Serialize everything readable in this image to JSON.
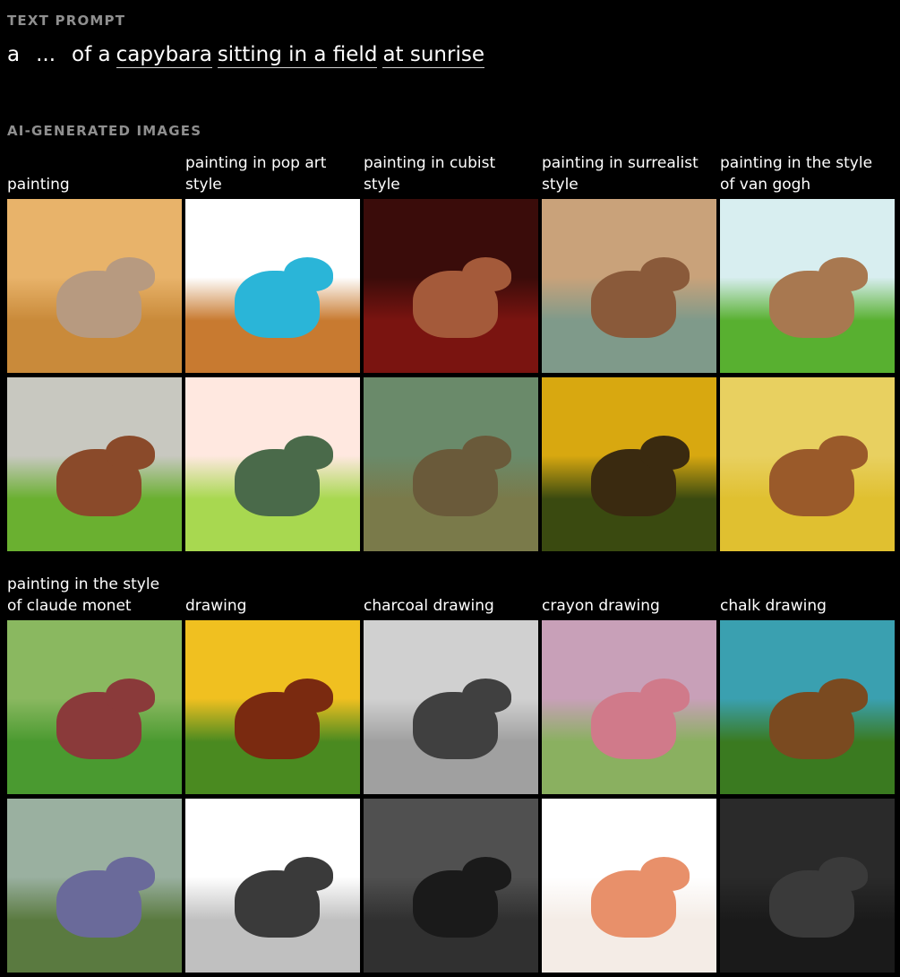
{
  "text_prompt_heading": "TEXT PROMPT",
  "prompt": {
    "a": "a",
    "ellipsis": "...",
    "of_a": "of a",
    "subject": "capybara",
    "action": "sitting in a field",
    "time": "at sunrise"
  },
  "images_heading": "AI-GENERATED IMAGES",
  "row1_labels": [
    [
      "",
      "painting"
    ],
    [
      "painting in pop art",
      "style"
    ],
    [
      "painting in cubist",
      "style"
    ],
    [
      "painting in surrealist",
      "style"
    ],
    [
      "painting in the style",
      "of van gogh"
    ]
  ],
  "row2_labels": [
    [
      "painting in the style",
      "of claude monet"
    ],
    [
      "",
      "drawing"
    ],
    [
      "",
      "charcoal drawing"
    ],
    [
      "",
      "crayon drawing"
    ],
    [
      "",
      "chalk drawing"
    ]
  ],
  "tiles": [
    {
      "name": "painting-image-1",
      "sky": "#e8b36a",
      "ground": "#c98a3a",
      "cap": "#b79a80"
    },
    {
      "name": "pop-art-image-1",
      "sky": "#ffffff",
      "ground": "#c87a30",
      "cap": "#2ab5d8"
    },
    {
      "name": "cubist-image-1",
      "sky": "#3a0c0a",
      "ground": "#7a1410",
      "cap": "#a45a3a"
    },
    {
      "name": "surrealist-image-1",
      "sky": "#c9a27a",
      "ground": "#7f9a8a",
      "cap": "#8a5a3a"
    },
    {
      "name": "van-gogh-image-1",
      "sky": "#d8eef0",
      "ground": "#58b030",
      "cap": "#a87850"
    },
    {
      "name": "painting-image-2",
      "sky": "#c8c8c0",
      "ground": "#6ab030",
      "cap": "#8a4a2a"
    },
    {
      "name": "pop-art-image-2",
      "sky": "#ffe8e0",
      "ground": "#a8d850",
      "cap": "#4a6a4a"
    },
    {
      "name": "cubist-image-2",
      "sky": "#6a8a6a",
      "ground": "#7a7a4a",
      "cap": "#6a5a3a"
    },
    {
      "name": "surrealist-image-2",
      "sky": "#d8a810",
      "ground": "#3a4a10",
      "cap": "#3a2a10"
    },
    {
      "name": "van-gogh-image-2",
      "sky": "#e8d060",
      "ground": "#e0c030",
      "cap": "#9a5a2a"
    },
    {
      "name": "monet-image-1",
      "sky": "#8ab860",
      "ground": "#4a9a30",
      "cap": "#8a3a3a"
    },
    {
      "name": "drawing-image-1",
      "sky": "#f0c020",
      "ground": "#4a8a20",
      "cap": "#7a2a10"
    },
    {
      "name": "charcoal-image-1",
      "sky": "#d0d0d0",
      "ground": "#a0a0a0",
      "cap": "#404040"
    },
    {
      "name": "crayon-image-1",
      "sky": "#c8a0b8",
      "ground": "#8ab060",
      "cap": "#d07a8a"
    },
    {
      "name": "chalk-image-1",
      "sky": "#3aa0b0",
      "ground": "#3a7a20",
      "cap": "#7a4a20"
    },
    {
      "name": "monet-image-2",
      "sky": "#9ab0a0",
      "ground": "#5a7a40",
      "cap": "#6a6a9a"
    },
    {
      "name": "drawing-image-2",
      "sky": "#ffffff",
      "ground": "#c0c0c0",
      "cap": "#3a3a3a"
    },
    {
      "name": "charcoal-image-2",
      "sky": "#505050",
      "ground": "#303030",
      "cap": "#1a1a1a"
    },
    {
      "name": "crayon-image-2",
      "sky": "#ffffff",
      "ground": "#f4ece6",
      "cap": "#e8906a"
    },
    {
      "name": "chalk-image-2",
      "sky": "#2a2a2a",
      "ground": "#1a1a1a",
      "cap": "#3a3a3a"
    }
  ]
}
